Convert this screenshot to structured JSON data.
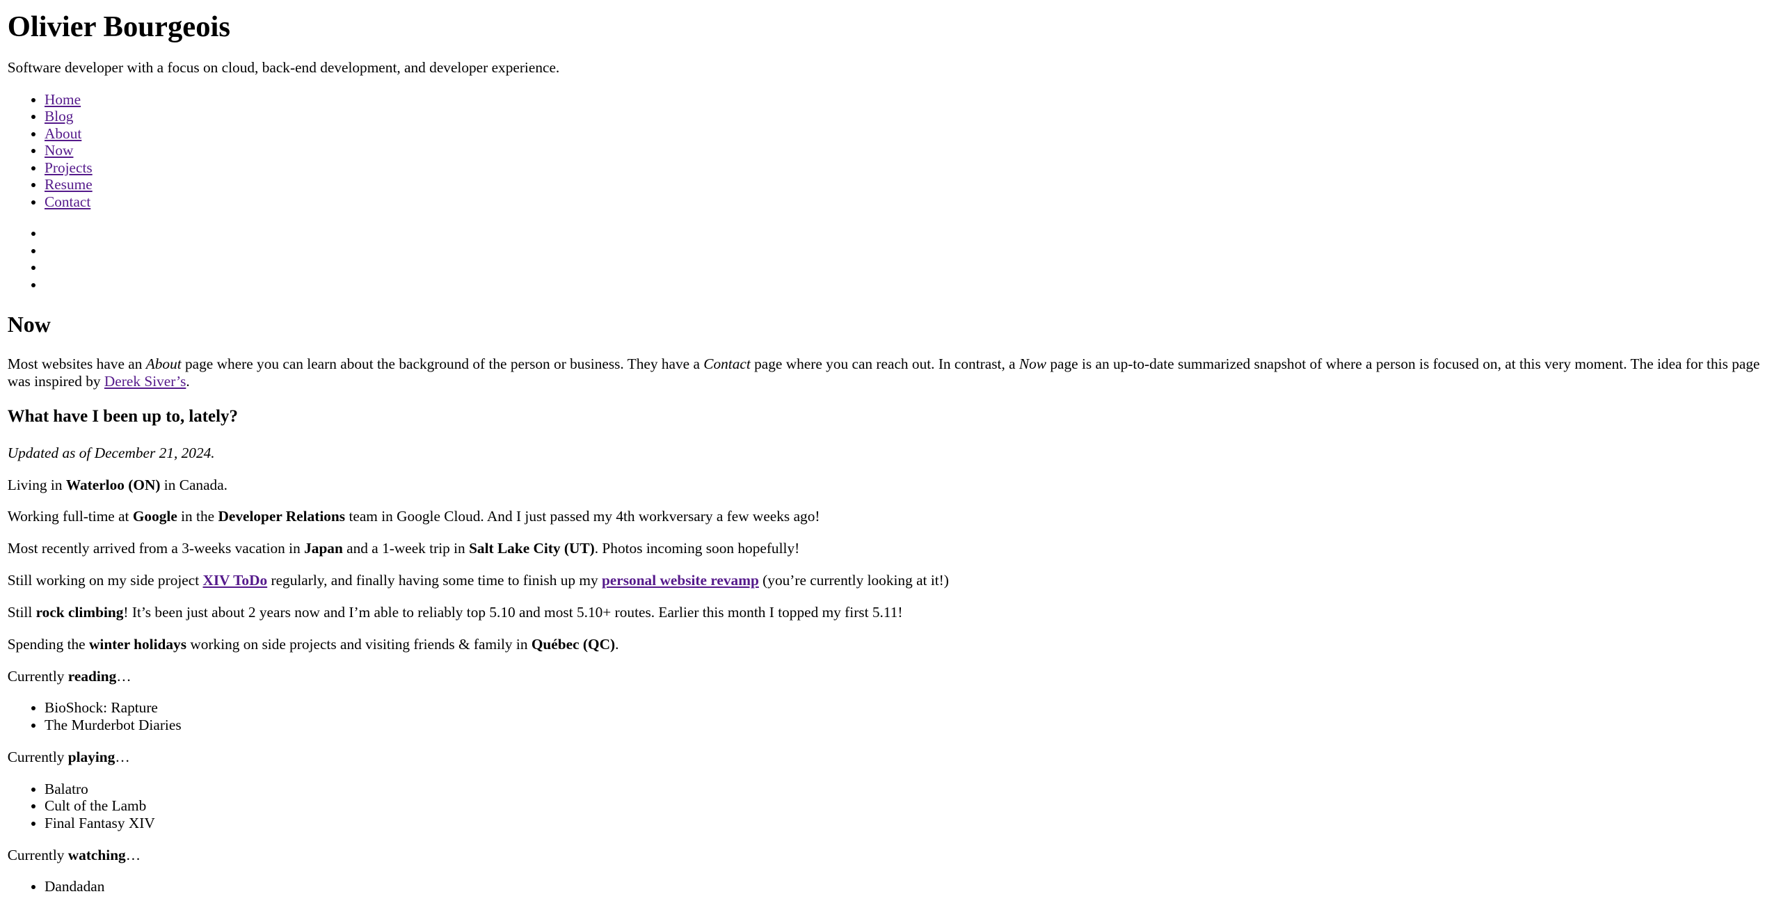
{
  "header": {
    "title": "Olivier Bourgeois",
    "tagline": "Software developer with a focus on cloud, back-end development, and developer experience."
  },
  "nav": {
    "items": [
      {
        "label": "Home"
      },
      {
        "label": "Blog"
      },
      {
        "label": "About"
      },
      {
        "label": "Now"
      },
      {
        "label": "Projects"
      },
      {
        "label": "Resume"
      },
      {
        "label": "Contact"
      }
    ]
  },
  "social": {
    "items": [
      {
        "icon": "social-link-1"
      },
      {
        "icon": "social-link-2"
      },
      {
        "icon": "social-link-3"
      },
      {
        "icon": "social-link-4"
      }
    ]
  },
  "main": {
    "title": "Now",
    "intro": {
      "t1": "Most websites have an ",
      "about": "About",
      "t2": " page where you can learn about the background of the person or business. They have a ",
      "contact": "Contact",
      "t3": " page where you can reach out. In contrast, a ",
      "now": "Now",
      "t4": " page is an up-to-date summarized snapshot of where a person is focused on, at this very moment. The idea for this page was inspired by ",
      "link": "Derek Siver’s",
      "t5": "."
    },
    "subtitle": "What have I been up to, lately?",
    "updated": "Updated as of December 21, 2024.",
    "living": {
      "t1": "Living in ",
      "b1": "Waterloo (ON)",
      "t2": " in Canada."
    },
    "working": {
      "t1": "Working full-time at ",
      "b1": "Google",
      "t2": " in the ",
      "b2": "Developer Relations",
      "t3": " team in Google Cloud. And I just passed my 4th workversary a few weeks ago!"
    },
    "travel": {
      "t1": "Most recently arrived from a 3-weeks vacation in ",
      "b1": "Japan",
      "t2": " and a 1-week trip in ",
      "b2": "Salt Lake City (UT)",
      "t3": ". Photos incoming soon hopefully!"
    },
    "projects": {
      "t1": "Still working on my side project ",
      "link1": "XIV ToDo",
      "t2": " regularly, and finally having some time to finish up my ",
      "link2": "personal website revamp",
      "t3": " (you’re currently looking at it!)"
    },
    "climbing": {
      "t1": "Still ",
      "b1": "rock climbing",
      "t2": "! It’s been just about 2 years now and I’m able to reliably top 5.10 and most 5.10+ routes. Earlier this month I topped my first 5.11!"
    },
    "holidays": {
      "t1": "Spending the ",
      "b1": "winter holidays",
      "t2": " working on side projects and visiting friends & family in ",
      "b2": "Québec (QC)",
      "t3": "."
    },
    "reading": {
      "t1": "Currently ",
      "b1": "reading",
      "t2": "…",
      "items": [
        "BioShock: Rapture",
        "The Murderbot Diaries"
      ]
    },
    "playing": {
      "t1": "Currently ",
      "b1": "playing",
      "t2": "…",
      "items": [
        "Balatro",
        "Cult of the Lamb",
        "Final Fantasy XIV"
      ]
    },
    "watching": {
      "t1": "Currently ",
      "b1": "watching",
      "t2": "…",
      "items": [
        "Dandadan"
      ]
    }
  },
  "colors": {
    "link_visited": "#551a8b",
    "text": "#000000",
    "background": "#ffffff"
  }
}
